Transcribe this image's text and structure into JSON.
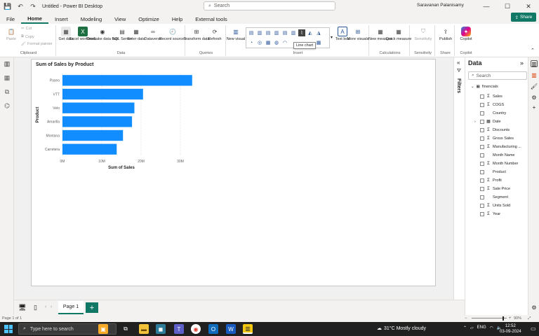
{
  "titlebar": {
    "title": "Untitled - Power BI Desktop",
    "search_placeholder": "Search",
    "user": "Saravanan Palanisamy"
  },
  "ribbon_tabs": [
    "File",
    "Home",
    "Insert",
    "Modeling",
    "View",
    "Optimize",
    "Help",
    "External tools"
  ],
  "active_tab": "Home",
  "share_label": "Share",
  "ribbon": {
    "clipboard": {
      "label": "Clipboard",
      "paste": "Paste",
      "cut": "Cut",
      "copy": "Copy",
      "format_painter": "Format painter"
    },
    "data": {
      "label": "Data",
      "get_data": "Get data",
      "excel": "Excel workbook",
      "onelake": "OneLake data hub",
      "sql": "SQL Server",
      "enter": "Enter data",
      "dataverse": "Dataverse",
      "recent": "Recent sources"
    },
    "queries": {
      "label": "Queries",
      "transform": "Transform data",
      "refresh": "Refresh"
    },
    "insert": {
      "label": "Insert",
      "new_visual": "New visual",
      "text_box": "Text box",
      "more_visuals": "More visuals"
    },
    "calculations": {
      "label": "Calculations",
      "new_measure": "New measure",
      "quick_measure": "Quick measure"
    },
    "sensitivity": {
      "label": "Sensitivity",
      "btn": "Sensitivity"
    },
    "share": {
      "label": "Share",
      "publish": "Publish"
    },
    "copilot": {
      "label": "Copilot",
      "btn": "Copilot"
    }
  },
  "tooltip": "Line chart",
  "chart_data": {
    "type": "bar",
    "orientation": "horizontal",
    "title": "Sum of Sales by Product",
    "xlabel": "Sum of Sales",
    "ylabel": "Product",
    "categories": [
      "Paseo",
      "VTT",
      "Velo",
      "Amarilla",
      "Montana",
      "Carretera"
    ],
    "values": [
      33000000,
      20500000,
      18300000,
      17700000,
      15400000,
      13800000
    ],
    "xlim": [
      0,
      35000000
    ],
    "xticks": [
      0,
      10000000,
      20000000,
      30000000
    ],
    "xtick_labels": [
      "0M",
      "10M",
      "20M",
      "30M"
    ],
    "color": "#118DFF",
    "grid": true
  },
  "filters_label": "Filters",
  "data_pane": {
    "title": "Data",
    "search_placeholder": "Search",
    "table": "financials",
    "fields": [
      {
        "name": "Sales",
        "sigma": true
      },
      {
        "name": "COGS",
        "sigma": true
      },
      {
        "name": "Country",
        "sigma": false
      },
      {
        "name": "Date",
        "sigma": false,
        "expandable": true
      },
      {
        "name": "Discounts",
        "sigma": true
      },
      {
        "name": "Gross Sales",
        "sigma": true
      },
      {
        "name": "Manufacturing ...",
        "sigma": true
      },
      {
        "name": "Month Name",
        "sigma": false
      },
      {
        "name": "Month Number",
        "sigma": true
      },
      {
        "name": "Product",
        "sigma": false
      },
      {
        "name": "Profit",
        "sigma": true
      },
      {
        "name": "Sale Price",
        "sigma": true
      },
      {
        "name": "Segment",
        "sigma": false
      },
      {
        "name": "Units Sold",
        "sigma": true
      },
      {
        "name": "Year",
        "sigma": true
      }
    ]
  },
  "page_tab": "Page 1",
  "status": {
    "page": "Page 1 of 1",
    "zoom": "90%"
  },
  "taskbar": {
    "search_placeholder": "Type here to search",
    "weather": "31°C  Mostly cloudy",
    "lang": "ENG",
    "time": "12:52",
    "date": "03-09-2024"
  }
}
